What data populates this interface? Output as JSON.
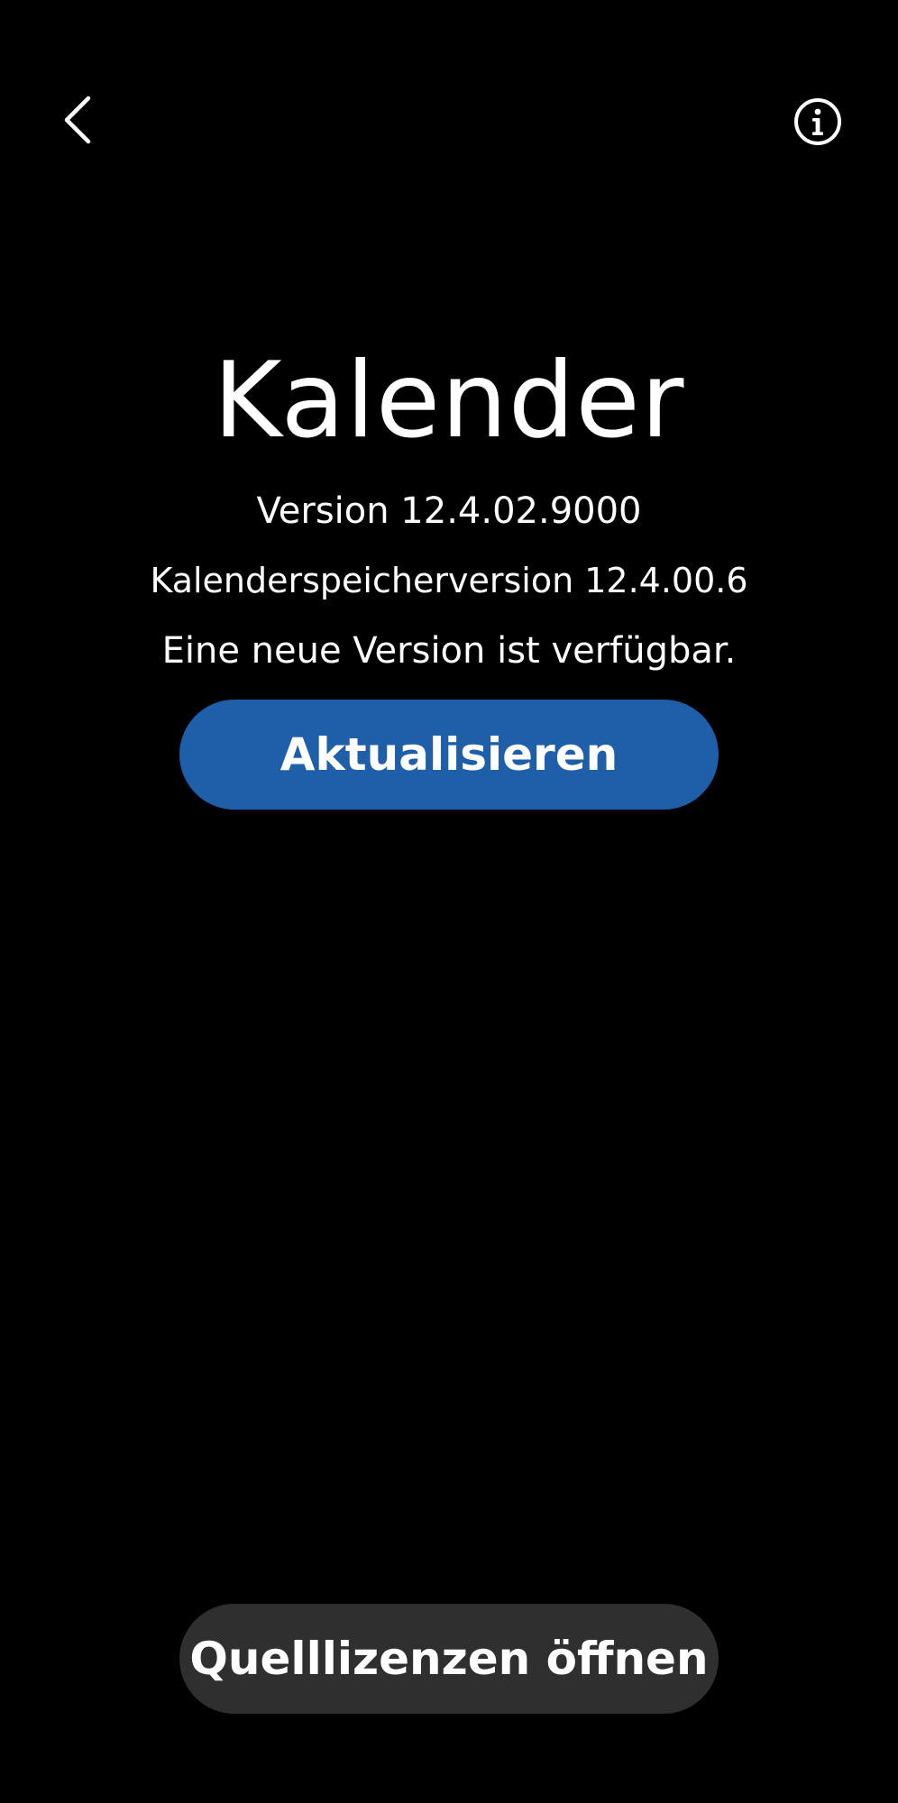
{
  "header": {
    "back_icon": "chevron-left-icon",
    "info_icon": "info-circle-icon"
  },
  "app": {
    "title": "Kalender",
    "version": "Version 12.4.02.9000",
    "storage_version": "Kalenderspeicherversion 12.4.00.6",
    "update_notice": "Eine neue Version ist verfügbar."
  },
  "actions": {
    "update_label": "Aktualisieren",
    "licenses_label": "Quelllizenzen öffnen"
  },
  "colors": {
    "background": "#000000",
    "text": "#ffffff",
    "update_button": "#1f5fa9",
    "licenses_button": "#2f2f2f"
  }
}
